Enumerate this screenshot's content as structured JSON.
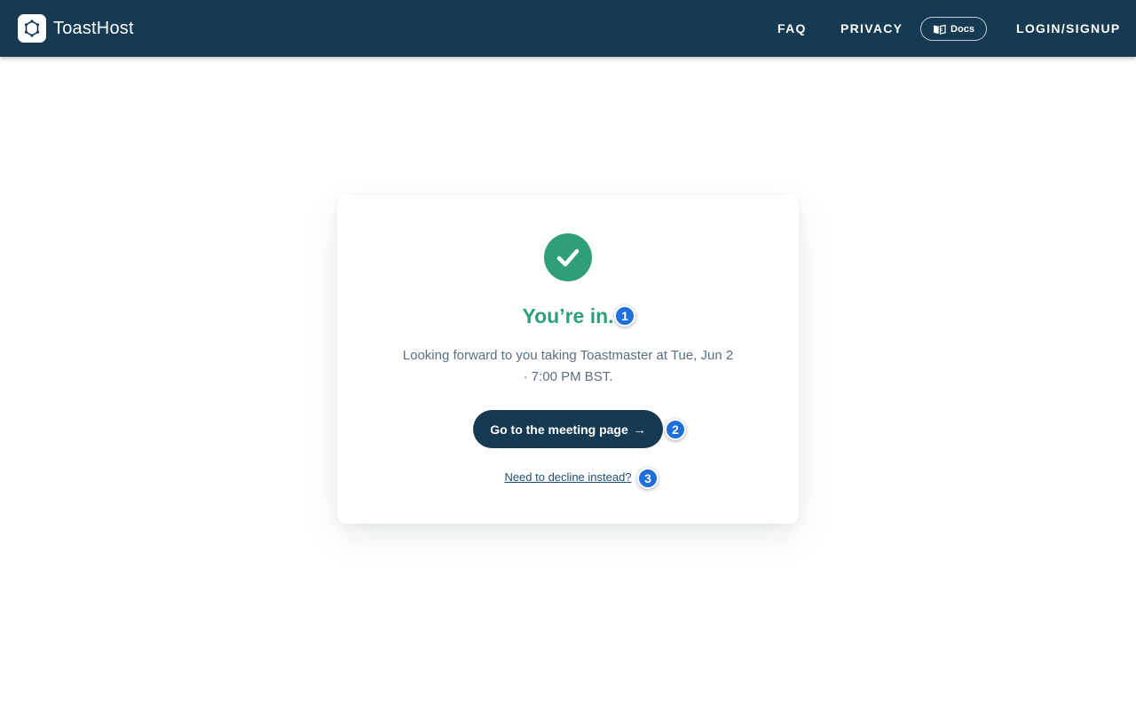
{
  "header": {
    "brand_name": "ToastHost",
    "nav": {
      "faq": "FAQ",
      "privacy": "PRIVACY",
      "docs": "Docs",
      "login": "LOGIN/SIGNUP"
    }
  },
  "confirmation": {
    "title": "You’re in.",
    "message_line1": "Looking forward to you taking Toastmaster at Tue, Jun 2",
    "message_line2": "· 7:00 PM BST.",
    "primary_button": "Go to the meeting page",
    "primary_button_arrow": "→",
    "decline_link": "Need to decline instead?"
  },
  "markers": [
    "1",
    "2",
    "3"
  ],
  "colors": {
    "header_bg": "#163a52",
    "success": "#2f9e7a",
    "marker": "#1e6fd9"
  },
  "icons": {
    "logo": "toasthost-logo-icon",
    "docs": "book-open-icon",
    "success": "check-circle-icon"
  }
}
